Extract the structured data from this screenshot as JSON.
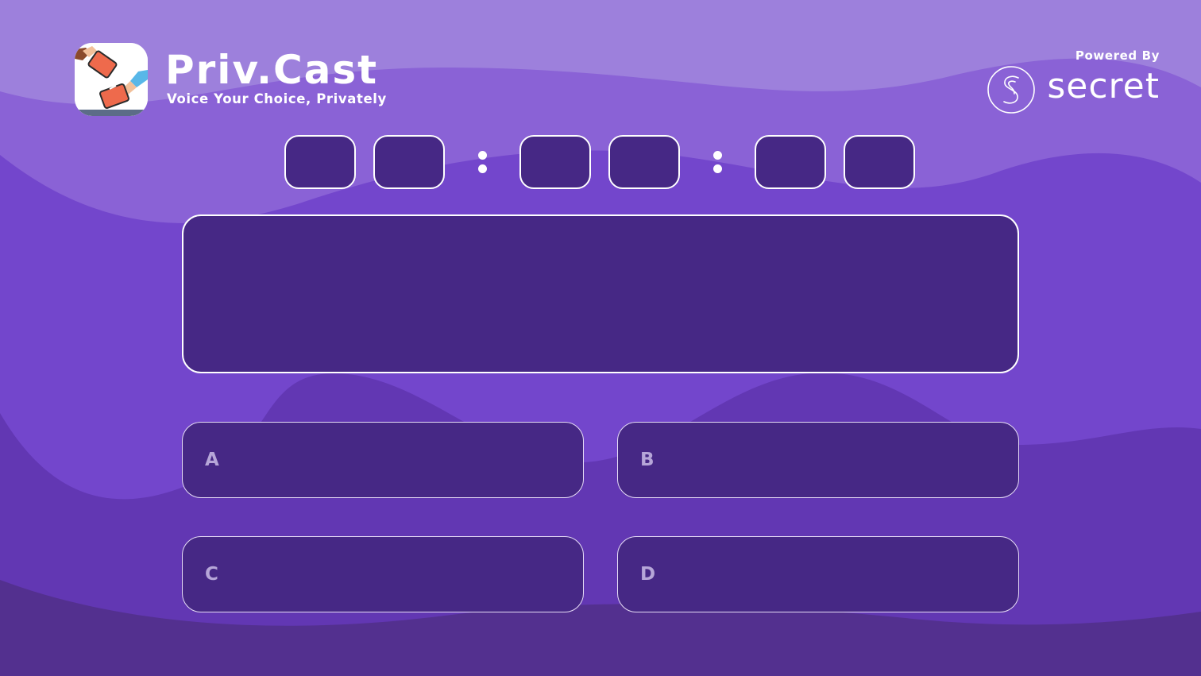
{
  "app": {
    "title": "Priv.Cast",
    "tagline": "Voice Your Choice, Privately"
  },
  "powered_by": {
    "label": "Powered By",
    "brand": "secret"
  },
  "timer": {
    "digits": [
      "",
      "",
      "",
      "",
      "",
      ""
    ],
    "separator": ":"
  },
  "question": {
    "text": ""
  },
  "options": [
    {
      "letter": "A",
      "text": ""
    },
    {
      "letter": "B",
      "text": ""
    },
    {
      "letter": "C",
      "text": ""
    },
    {
      "letter": "D",
      "text": ""
    }
  ],
  "colors": {
    "background": "#7048c8",
    "panel": "#462885",
    "border": "#ffffff",
    "option_letter": "#b6a6d8"
  },
  "icons": {
    "app_logo": "ballot-hands-icon",
    "powered_logo": "secret-network-icon"
  }
}
